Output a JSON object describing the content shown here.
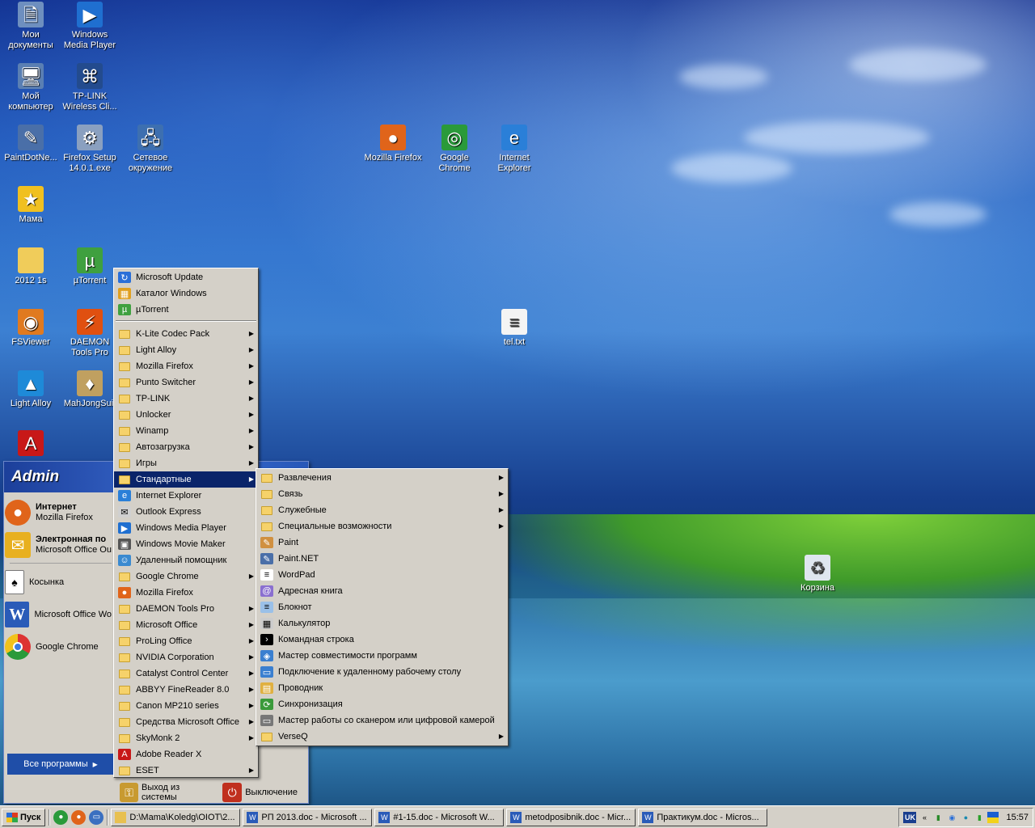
{
  "desktop": {
    "icons": [
      {
        "name": "Мои документы",
        "icon": "documents-folder-icon",
        "color": "#6e8fbf"
      },
      {
        "name": "Windows Media Player",
        "icon": "media-player-icon",
        "color": "#1f6fd0"
      },
      {
        "name": "Мой компьютер",
        "icon": "my-computer-icon",
        "color": "#5a7fb3"
      },
      {
        "name": "TP-LINK Wireless Cli...",
        "icon": "tplink-icon",
        "color": "#234b8e"
      },
      {
        "name": "PaintDotNe...",
        "icon": "paintdotnet-icon",
        "color": "#4a6fa8"
      },
      {
        "name": "Firefox Setup 14.0.1.exe",
        "icon": "installer-icon",
        "color": "#8aa0c0"
      },
      {
        "name": "Сетевое окружение",
        "icon": "network-icon",
        "color": "#3d6fb0"
      },
      {
        "name": "Мама",
        "icon": "star-icon",
        "color": "#f0c020"
      },
      {
        "name": "2012 1s",
        "icon": "folder-icon",
        "color": "#f0cc5a"
      },
      {
        "name": "µTorrent",
        "icon": "utorrent-icon",
        "color": "#3fa03f"
      },
      {
        "name": "FSViewer",
        "icon": "fsviewer-icon",
        "color": "#e07a20"
      },
      {
        "name": "DAEMON Tools Pro",
        "icon": "daemon-tools-icon",
        "color": "#e05010"
      },
      {
        "name": "Light Alloy",
        "icon": "light-alloy-icon",
        "color": "#1e8ad8"
      },
      {
        "name": "MahJongSuit",
        "icon": "mahjong-icon",
        "color": "#c0a060"
      },
      {
        "name": "",
        "icon": "adobe-reader-icon",
        "color": "#c81818"
      },
      {
        "name": "Mozilla Firefox",
        "icon": "firefox-icon",
        "color": "#e0641a"
      },
      {
        "name": "Google Chrome",
        "icon": "chrome-icon",
        "color": "#2a9a3a"
      },
      {
        "name": "Internet Explorer",
        "icon": "ie-icon",
        "color": "#2a7fd8"
      },
      {
        "name": "tel.txt",
        "icon": "text-file-icon",
        "color": "#f4f4f4"
      },
      {
        "name": "Корзина",
        "icon": "recycle-bin-icon",
        "color": "#dfe6ef"
      }
    ]
  },
  "start_menu": {
    "user": "Admin",
    "pinned": [
      {
        "line1": "Интернет",
        "line2": "Mozilla Firefox",
        "icon": "firefox-icon",
        "color": "#e0641a"
      },
      {
        "line1": "Электронная по",
        "line2": "Microsoft Office Ou",
        "icon": "outlook-icon",
        "color": "#e8b020"
      }
    ],
    "recent": [
      {
        "label": "Косынка",
        "icon": "solitaire-icon",
        "color": "#ffffff"
      },
      {
        "label": "Microsoft Office Wo",
        "icon": "word-icon",
        "color": "#2a5bb8"
      },
      {
        "label": "Google Chrome",
        "icon": "chrome-icon",
        "color": "#2a9a3a"
      }
    ],
    "all_programs": "Все программы",
    "logoff": "Выход из системы",
    "shutdown": "Выключение"
  },
  "programs_menu": {
    "top": [
      {
        "label": "Microsoft Update",
        "icon": "update-icon",
        "submenu": false
      },
      {
        "label": "Каталог Windows",
        "icon": "windows-catalog-icon",
        "submenu": false
      },
      {
        "label": "µTorrent",
        "icon": "utorrent-icon",
        "submenu": false
      }
    ],
    "items": [
      {
        "label": "K-Lite Codec Pack",
        "icon": "folder-icon",
        "submenu": true
      },
      {
        "label": "Light Alloy",
        "icon": "folder-icon",
        "submenu": true
      },
      {
        "label": "Mozilla Firefox",
        "icon": "folder-icon",
        "submenu": true
      },
      {
        "label": "Punto Switcher",
        "icon": "folder-icon",
        "submenu": true
      },
      {
        "label": "TP-LINK",
        "icon": "folder-icon",
        "submenu": true
      },
      {
        "label": "Unlocker",
        "icon": "folder-icon",
        "submenu": true
      },
      {
        "label": "Winamp",
        "icon": "folder-icon",
        "submenu": true
      },
      {
        "label": "Автозагрузка",
        "icon": "folder-icon",
        "submenu": true
      },
      {
        "label": "Игры",
        "icon": "folder-icon",
        "submenu": true
      },
      {
        "label": "Стандартные",
        "icon": "folder-icon",
        "submenu": true,
        "selected": true
      },
      {
        "label": "Internet Explorer",
        "icon": "ie-icon",
        "submenu": false
      },
      {
        "label": "Outlook Express",
        "icon": "outlook-express-icon",
        "submenu": false
      },
      {
        "label": "Windows Media Player",
        "icon": "media-player-icon",
        "submenu": false
      },
      {
        "label": "Windows Movie Maker",
        "icon": "movie-maker-icon",
        "submenu": false
      },
      {
        "label": "Удаленный помощник",
        "icon": "remote-assistance-icon",
        "submenu": false
      },
      {
        "label": "Google Chrome",
        "icon": "folder-icon",
        "submenu": true
      },
      {
        "label": "Mozilla Firefox",
        "icon": "firefox-icon",
        "submenu": false
      },
      {
        "label": "DAEMON Tools Pro",
        "icon": "folder-icon",
        "submenu": true
      },
      {
        "label": "Microsoft Office",
        "icon": "folder-icon",
        "submenu": true
      },
      {
        "label": "ProLing Office",
        "icon": "folder-icon",
        "submenu": true
      },
      {
        "label": "NVIDIA Corporation",
        "icon": "folder-icon",
        "submenu": true
      },
      {
        "label": "Catalyst Control Center",
        "icon": "folder-icon",
        "submenu": true
      },
      {
        "label": "ABBYY FineReader 8.0",
        "icon": "folder-icon",
        "submenu": true
      },
      {
        "label": "Canon MP210 series",
        "icon": "folder-icon",
        "submenu": true
      },
      {
        "label": "Средства Microsoft Office",
        "icon": "folder-icon",
        "submenu": true
      },
      {
        "label": "SkyMonk 2",
        "icon": "folder-icon",
        "submenu": true
      },
      {
        "label": "Adobe Reader X",
        "icon": "adobe-reader-icon",
        "submenu": false
      },
      {
        "label": "ESET",
        "icon": "folder-icon",
        "submenu": true
      }
    ]
  },
  "accessories_menu": {
    "items": [
      {
        "label": "Развлечения",
        "icon": "folder-icon",
        "submenu": true
      },
      {
        "label": "Связь",
        "icon": "folder-icon",
        "submenu": true
      },
      {
        "label": "Служебные",
        "icon": "folder-icon",
        "submenu": true
      },
      {
        "label": "Специальные возможности",
        "icon": "folder-icon",
        "submenu": true
      },
      {
        "label": "Paint",
        "icon": "paint-icon",
        "submenu": false
      },
      {
        "label": "Paint.NET",
        "icon": "paintdotnet-icon",
        "submenu": false
      },
      {
        "label": "WordPad",
        "icon": "wordpad-icon",
        "submenu": false
      },
      {
        "label": "Адресная книга",
        "icon": "address-book-icon",
        "submenu": false
      },
      {
        "label": "Блокнот",
        "icon": "notepad-icon",
        "submenu": false
      },
      {
        "label": "Калькулятор",
        "icon": "calculator-icon",
        "submenu": false
      },
      {
        "label": "Командная строка",
        "icon": "cmd-icon",
        "submenu": false
      },
      {
        "label": "Мастер совместимости программ",
        "icon": "compatibility-wizard-icon",
        "submenu": false
      },
      {
        "label": "Подключение к удаленному рабочему столу",
        "icon": "remote-desktop-icon",
        "submenu": false
      },
      {
        "label": "Проводник",
        "icon": "explorer-icon",
        "submenu": false
      },
      {
        "label": "Синхронизация",
        "icon": "sync-icon",
        "submenu": false
      },
      {
        "label": "Мастер работы со сканером или цифровой камерой",
        "icon": "scanner-wizard-icon",
        "submenu": false
      },
      {
        "label": "VerseQ",
        "icon": "folder-icon",
        "submenu": true
      }
    ]
  },
  "taskbar": {
    "start_label": "Пуск",
    "quick_launch": [
      {
        "icon": "chrome-icon",
        "color": "#2a9a3a"
      },
      {
        "icon": "firefox-icon",
        "color": "#e0641a"
      },
      {
        "icon": "show-desktop-icon",
        "color": "#3a6fc0"
      }
    ],
    "buttons": [
      {
        "label": "D:\\Mama\\Koledg\\OIOT\\2...",
        "icon": "folder-icon",
        "color": "#e8c050"
      },
      {
        "label": "РП 2013.doc - Microsoft ...",
        "icon": "word-icon",
        "color": "#2a5bb8"
      },
      {
        "label": "#1-15.doc - Microsoft W...",
        "icon": "word-icon",
        "color": "#2a5bb8"
      },
      {
        "label": "metodposibnik.doc - Micr...",
        "icon": "word-icon",
        "color": "#2a5bb8"
      },
      {
        "label": "Практикум.doc - Micros...",
        "icon": "word-icon",
        "color": "#2a5bb8"
      }
    ],
    "tray": {
      "lang": "UK",
      "expand": "«",
      "clock": "15:57"
    }
  }
}
